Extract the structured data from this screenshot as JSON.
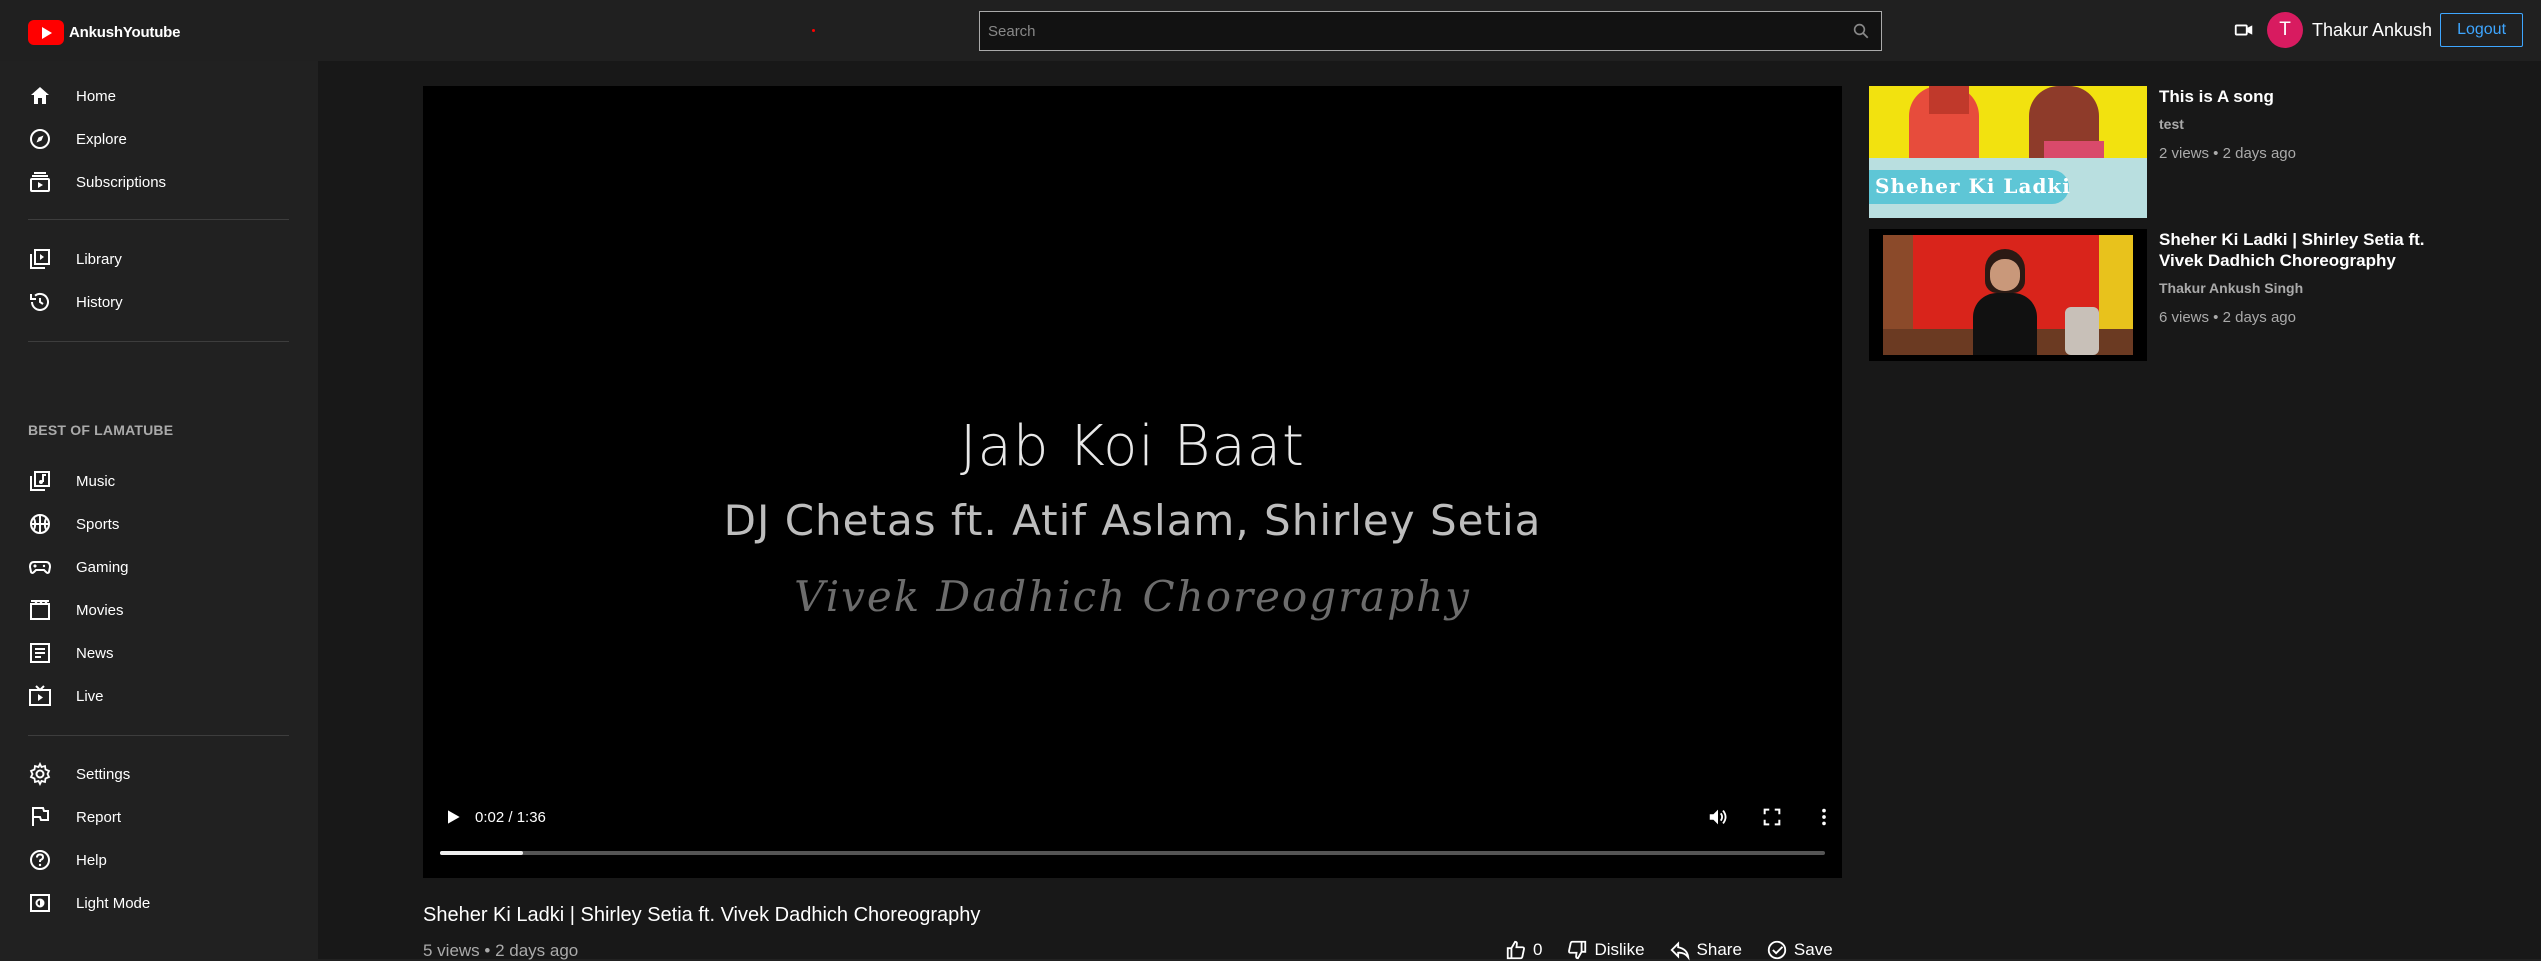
{
  "app": {
    "name": "AnkushYoutube"
  },
  "search": {
    "placeholder": "Search"
  },
  "user": {
    "avatar_letter": "T",
    "name": "Thakur Ankush",
    "logout_label": "Logout"
  },
  "sidebar": {
    "main": [
      {
        "label": "Home",
        "icon": "home-icon"
      },
      {
        "label": "Explore",
        "icon": "compass-icon"
      },
      {
        "label": "Subscriptions",
        "icon": "subscriptions-icon"
      }
    ],
    "library": [
      {
        "label": "Library",
        "icon": "library-icon"
      },
      {
        "label": "History",
        "icon": "history-icon"
      }
    ],
    "section_title": "BEST OF LAMATUBE",
    "best": [
      {
        "label": "Music",
        "icon": "music-icon"
      },
      {
        "label": "Sports",
        "icon": "sports-icon"
      },
      {
        "label": "Gaming",
        "icon": "gaming-icon"
      },
      {
        "label": "Movies",
        "icon": "movies-icon"
      },
      {
        "label": "News",
        "icon": "news-icon"
      },
      {
        "label": "Live",
        "icon": "live-icon"
      }
    ],
    "bottom": [
      {
        "label": "Settings",
        "icon": "gear-icon"
      },
      {
        "label": "Report",
        "icon": "flag-icon"
      },
      {
        "label": "Help",
        "icon": "help-icon"
      },
      {
        "label": "Light Mode",
        "icon": "light-mode-icon"
      }
    ]
  },
  "player": {
    "overlay_line1": "Jab Koi Baat",
    "overlay_line2": "DJ Chetas ft. Atif Aslam, Shirley Setia",
    "overlay_line3": "Vivek Dadhich Choreography",
    "time": "0:02 / 1:36",
    "progress_fraction": 0.06
  },
  "video": {
    "title": "Sheher Ki Ladki | Shirley Setia ft. Vivek Dadhich Choreography",
    "meta": "5 views • 2 days ago",
    "likes": "0",
    "dislike_label": "Dislike",
    "share_label": "Share",
    "save_label": "Save"
  },
  "related": [
    {
      "title": "This is A song",
      "channel": "test",
      "meta": "2 views • 2 days ago",
      "thumb_caption": "Sheher Ki Ladki"
    },
    {
      "title": "Sheher Ki Ladki | Shirley Setia ft. Vivek Dadhich Choreography",
      "channel": "Thakur Ankush Singh",
      "meta": "6 views • 2 days ago"
    }
  ],
  "colors": {
    "accent": "#3ea6ff",
    "brand": "#ff0000",
    "avatar": "#d81b60"
  }
}
